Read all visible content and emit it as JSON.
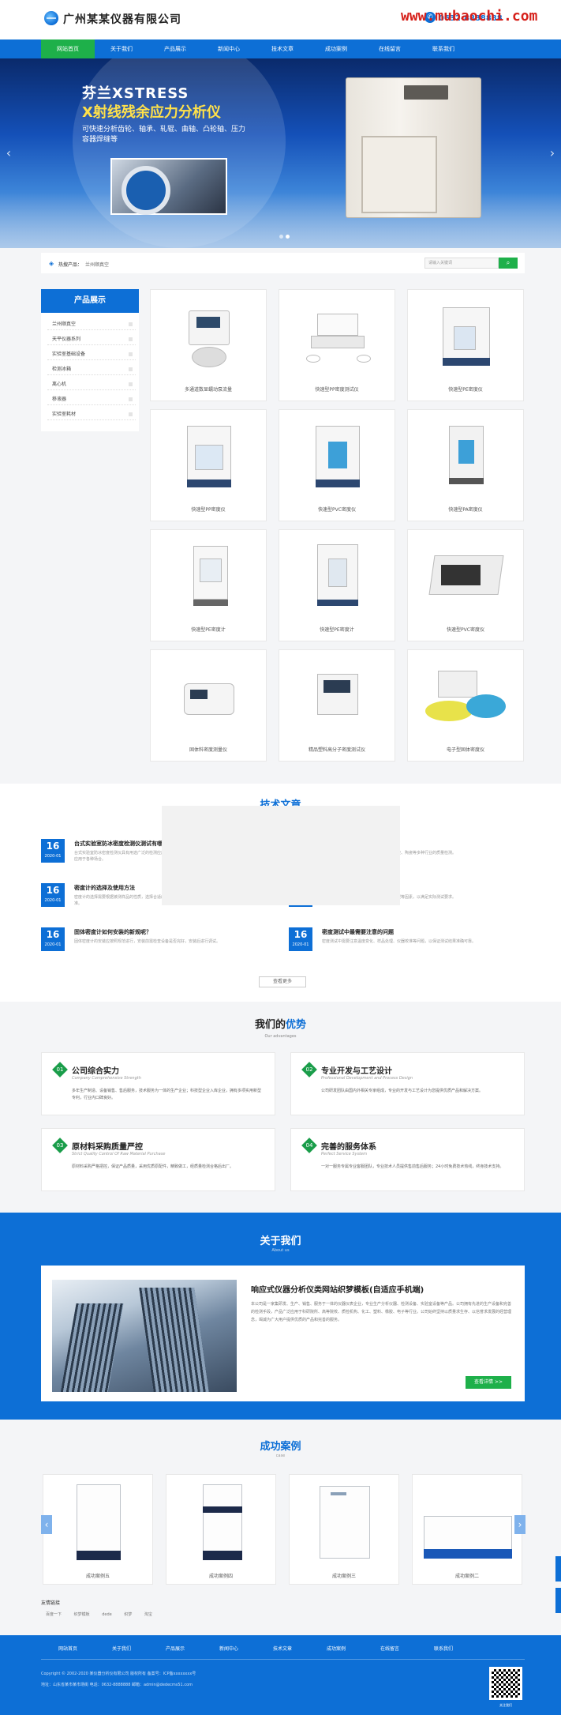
{
  "header": {
    "company_name": "广州某某仪器有限公司",
    "phone": "0632-8888888",
    "watermark": "www.mubaochi.com"
  },
  "nav": [
    "网站首页",
    "关于我们",
    "产品展示",
    "新闻中心",
    "技术文章",
    "成功案例",
    "在线留言",
    "联系我们"
  ],
  "banner": {
    "title_line1": "芬兰XSTRESS",
    "title_line2": "X射线残余应力分析仪",
    "subtitle": "可快速分析齿轮、轴承、轧辊、曲轴、凸轮轴、压力容器焊缝等",
    "active_slide": 2,
    "slide_count": 2
  },
  "search": {
    "hot_label": "热搜产品：",
    "hot_words": "兰州顺真空",
    "placeholder": "请输入关键词",
    "button_icon": "search-icon"
  },
  "sidebar": {
    "title": "产品展示",
    "items": [
      "兰州顺真空",
      "天平仪器系列",
      "实验室基础设备",
      "检测冰箱",
      "离心机",
      "移液器",
      "实验室耗材"
    ]
  },
  "products": [
    "多通道数显蠕动泵流量",
    "快速型PP密度测试仪",
    "快速型PE密度仪",
    "快速型PP密度仪",
    "快速型PVC密度仪",
    "快速型PA密度仪",
    "快速型PE密度计",
    "快速型PE密度计",
    "快速型PVC密度仪",
    "固体料密度测量仪",
    "精品塑料高分子密度测试仪",
    "电子型固体密度仪"
  ],
  "tech": {
    "title": "技术文章",
    "more": "查看更多",
    "articles": [
      {
        "day": "16",
        "ym": "2020-01",
        "title": "台式实验室防冰密度检测仪测试有哪",
        "desc": "台式实验室防冰密度检测仪具有用途广泛的检测应用，在科研生产中起到重要作用，可广泛应用于各种场合。"
      },
      {
        "day": "16",
        "ym": "2020-01",
        "title": "密度计的选择及使用方法",
        "desc": "密度计的选择需要根据被测样品的性质，选择合适的测量范围与精度等级，使用前应进行校准。"
      },
      {
        "day": "16",
        "ym": "2020-01",
        "title": "固体密度计如何安装的新规呢？",
        "desc": "固体密度计的安装应按照规范进行，安装前需检查设备是否完好，安装后进行调试。"
      },
      {
        "day": "16",
        "ym": "2020-01",
        "title": "",
        "desc": "密度测量应用广泛，可用于化工、塑料、橡胶、陶瓷等多种行业的质量检测。"
      },
      {
        "day": "16",
        "ym": "2020-01",
        "title": "",
        "desc": "选择密度计需考虑测量范围、精度、样品类型等因素，以满足实际测试要求。"
      },
      {
        "day": "16",
        "ym": "2020-01",
        "title": "密度测试中最需要注意的问题",
        "desc": "密度测试中需要注意温度变化、样品处理、仪器校准等问题，以保证测试结果准确可靠。"
      }
    ]
  },
  "advantages": {
    "title_a": "我们的",
    "title_b": "优势",
    "subtitle": "Our advantages",
    "items": [
      {
        "num": "01",
        "name": "公司综合实力",
        "en": "Company Comprehensive Strength",
        "desc": "多年生产制造、设备销售、售后服务，技术服务为一体的生产企业；科技型企业入库企业，拥有多项实用新型专利，行业内口碑良好。"
      },
      {
        "num": "02",
        "name": "专业开发与工艺设计",
        "en": "Professional Development and Process Design",
        "desc": "公司研发团队由国内外相关专家组成，专业的开发与工艺设计为您提供优质产品和解决方案。"
      },
      {
        "num": "03",
        "name": "原材料采购质量严控",
        "en": "Strict Quality Control Of Raw Material Purchase",
        "desc": "原材料采购严格把控，保证产品质量，采用优质原配件，精致做工，经质量检测合格后出厂。"
      },
      {
        "num": "04",
        "name": "完善的服务体系",
        "en": "Perfect Service System",
        "desc": "一对一服务专属专业客服团队，专业技术人员提供售前售后服务；24小时免费技术热线，终身技术支持。"
      }
    ]
  },
  "about": {
    "title": "关于我们",
    "subtitle": "About us",
    "heading": "响应式仪器分析仪类网站织梦模板(自适应手机端)",
    "text": "本公司是一家集研发、生产、销售、服务于一体的仪器仪表企业，专业生产分析仪器、检测设备、实验室设备等产品。公司拥有先进的生产设备和完善的检测手段，产品广泛应用于科研院所、高等院校、质检机构、化工、塑料、橡胶、电子等行业。公司始终坚持以质量求生存、以信誉求发展的经营理念，竭诚为广大用户提供优质的产品和完善的服务。",
    "button": "查看详情 >>"
  },
  "cases": {
    "title": "成功案例",
    "subtitle": "case",
    "items": [
      "成功案例五",
      "成功案例四",
      "成功案例三",
      "成功案例二"
    ]
  },
  "links": {
    "label": "友情链接",
    "items": [
      "百度一下",
      "织梦模板",
      "dede",
      "织梦",
      "淘宝"
    ]
  },
  "footer": {
    "nav": [
      "网站首页",
      "关于我们",
      "产品展示",
      "新闻中心",
      "技术文章",
      "成功案例",
      "在线留言",
      "联系我们"
    ],
    "copyright": "Copyright © 2002-2020 某仪器分析仪有限公司 版权所有  备案号：ICP备xxxxxxxx号",
    "address": "地址：山东省某市某市场街  电话：0632-8888888  邮箱：admin@dedecms51.com",
    "qr_label": "关注我们"
  },
  "colors": {
    "primary": "#0d6fd6",
    "accent": "#1eb04a",
    "highlight": "#ffe14a"
  }
}
